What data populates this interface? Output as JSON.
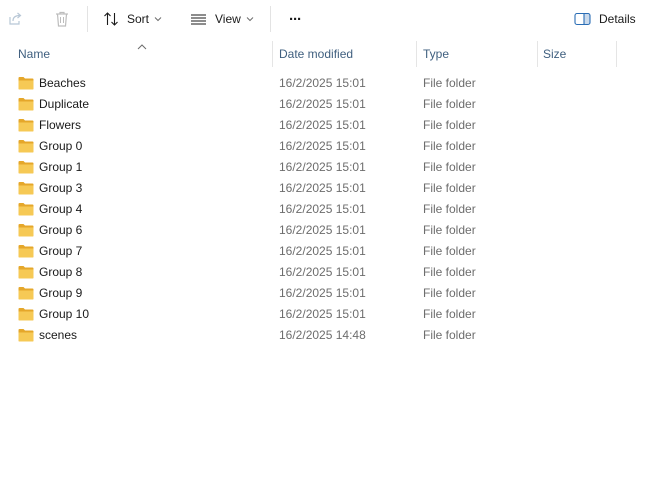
{
  "toolbar": {
    "sort_label": "Sort",
    "view_label": "View",
    "more_label": "···",
    "details_label": "Details"
  },
  "columns": {
    "name": "Name",
    "date": "Date modified",
    "type": "Type",
    "size": "Size"
  },
  "rows": [
    {
      "name": "Beaches",
      "date": "16/2/2025 15:01",
      "type": "File folder"
    },
    {
      "name": "Duplicate",
      "date": "16/2/2025 15:01",
      "type": "File folder"
    },
    {
      "name": "Flowers",
      "date": "16/2/2025 15:01",
      "type": "File folder"
    },
    {
      "name": "Group 0",
      "date": "16/2/2025 15:01",
      "type": "File folder"
    },
    {
      "name": "Group 1",
      "date": "16/2/2025 15:01",
      "type": "File folder"
    },
    {
      "name": "Group 3",
      "date": "16/2/2025 15:01",
      "type": "File folder"
    },
    {
      "name": "Group 4",
      "date": "16/2/2025 15:01",
      "type": "File folder"
    },
    {
      "name": "Group 6",
      "date": "16/2/2025 15:01",
      "type": "File folder"
    },
    {
      "name": "Group 7",
      "date": "16/2/2025 15:01",
      "type": "File folder"
    },
    {
      "name": "Group 8",
      "date": "16/2/2025 15:01",
      "type": "File folder"
    },
    {
      "name": "Group 9",
      "date": "16/2/2025 15:01",
      "type": "File folder"
    },
    {
      "name": "Group 10",
      "date": "16/2/2025 15:01",
      "type": "File folder"
    },
    {
      "name": "scenes",
      "date": "16/2/2025 14:48",
      "type": "File folder"
    }
  ],
  "icons": {
    "share": "share-icon",
    "delete": "trash-icon",
    "sort": "sort-arrows-icon",
    "view": "view-lines-icon",
    "details": "details-pane-icon",
    "folder": "folder-icon"
  },
  "colors": {
    "folder_yellow": "#f2c04c",
    "folder_yellow_dark": "#e5a72a",
    "header_text": "#3f5f7f",
    "secondary_text": "#6d6d6d",
    "details_icon_blue": "#2a6db5"
  }
}
